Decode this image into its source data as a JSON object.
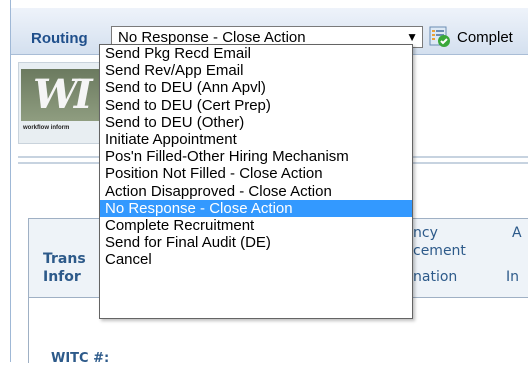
{
  "toolbar": {
    "routing_label": "Routing",
    "routing_value": "No Response - Close Action",
    "complete_label": "Complet"
  },
  "logo": {
    "tagline": "workflow inform"
  },
  "table": {
    "headers": [
      "Trans",
      "Infor",
      "ncy",
      "cement",
      "nation",
      "A",
      "In"
    ],
    "witc_label": "WITC #:"
  },
  "routing_options": [
    "Send Pkg Recd Email",
    "Send Rev/App Email",
    "Send to DEU (Ann Apvl)",
    "Send to DEU (Cert Prep)",
    "Send to DEU (Other)",
    "Initiate Appointment",
    "Pos'n Filled-Other Hiring Mechanism",
    "Position Not Filled - Close Action",
    "Action Disapproved - Close Action",
    "No Response - Close Action",
    "Complete Recruitment",
    "Send for Final Audit (DE)",
    "Cancel"
  ],
  "selected_index": 9,
  "colors": {
    "selection": "#3399ff",
    "label": "#1f4f8b"
  }
}
